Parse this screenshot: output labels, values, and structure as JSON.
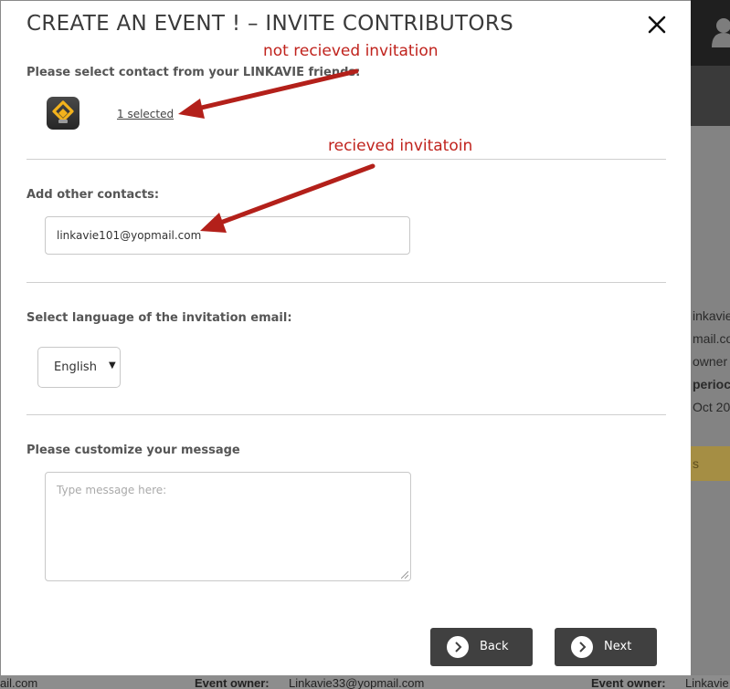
{
  "modal": {
    "title": "CREATE AN EVENT ! – INVITE CONTRIBUTORS",
    "close_icon": "close-icon",
    "friends_label": "Please select contact from your LINKAVIE friends:",
    "app_icon": "linkavie-logo-icon",
    "selected_link": "1 selected",
    "other_contacts_label": "Add other contacts:",
    "other_contacts_value": "linkavie101@yopmail.com",
    "language_label": "Select language of the invitation email:",
    "language_selected": "English",
    "message_label": "Please customize your message",
    "message_placeholder": "Type message here:",
    "back_label": "Back",
    "next_label": "Next",
    "button_icon": "chevron-right-icon"
  },
  "annotations": {
    "top": "not recieved invitation",
    "bottom": "recieved invitatoin",
    "color": "#c0231d"
  },
  "background_page": {
    "lines": [
      "inkavie",
      "mail.co",
      "owner",
      "perioc",
      "Oct 20"
    ],
    "gold_text": "s",
    "footer": {
      "left_text": "ail.com",
      "mid_label": "Event owner:",
      "mid_value": "Linkavie33@yopmail.com",
      "right_label": "Event owner:",
      "right_value": "Linkavie"
    }
  }
}
